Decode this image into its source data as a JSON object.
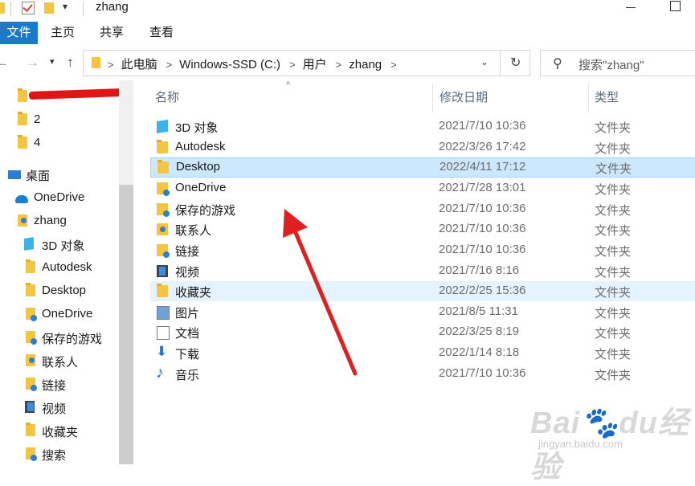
{
  "window": {
    "title": "zhang"
  },
  "ribbon": {
    "tabs": [
      "文件",
      "主页",
      "共享",
      "查看"
    ]
  },
  "address": {
    "breadcrumbs": [
      "此电脑",
      "Windows-SSD (C:)",
      "用户",
      "zhang"
    ],
    "search_placeholder": "搜索\"zhang\""
  },
  "nav_pane": {
    "items": [
      {
        "label": "2",
        "icon": "folder-icon"
      },
      {
        "label": "4",
        "icon": "folder-icon"
      },
      {
        "label": "桌面",
        "icon": "desktop-icon"
      },
      {
        "label": "OneDrive",
        "icon": "onedrive-icon"
      },
      {
        "label": "zhang",
        "icon": "user-folder-icon"
      },
      {
        "label": "3D 对象",
        "icon": "cube-icon"
      },
      {
        "label": "Autodesk",
        "icon": "folder-icon"
      },
      {
        "label": "Desktop",
        "icon": "folder-icon"
      },
      {
        "label": "OneDrive",
        "icon": "onedrive-folder-icon"
      },
      {
        "label": "保存的游戏",
        "icon": "saved-games-icon"
      },
      {
        "label": "联系人",
        "icon": "contacts-icon"
      },
      {
        "label": "链接",
        "icon": "links-icon"
      },
      {
        "label": "视频",
        "icon": "video-icon"
      },
      {
        "label": "收藏夹",
        "icon": "favorites-icon"
      },
      {
        "label": "搜索",
        "icon": "searches-icon"
      }
    ]
  },
  "columns": {
    "name": "名称",
    "modified": "修改日期",
    "type": "类型"
  },
  "files": [
    {
      "name": "3D 对象",
      "modified": "2021/7/10 10:36",
      "type": "文件夹",
      "icon": "cube-icon"
    },
    {
      "name": "Autodesk",
      "modified": "2022/3/26 17:42",
      "type": "文件夹",
      "icon": "folder-icon"
    },
    {
      "name": "Desktop",
      "modified": "2022/4/11 17:12",
      "type": "文件夹",
      "icon": "folder-icon",
      "selected": true
    },
    {
      "name": "OneDrive",
      "modified": "2021/7/28 13:01",
      "type": "文件夹",
      "icon": "onedrive-folder-icon"
    },
    {
      "name": "保存的游戏",
      "modified": "2021/7/10 10:36",
      "type": "文件夹",
      "icon": "saved-games-icon"
    },
    {
      "name": "联系人",
      "modified": "2021/7/10 10:36",
      "type": "文件夹",
      "icon": "contacts-icon"
    },
    {
      "name": "链接",
      "modified": "2021/7/10 10:36",
      "type": "文件夹",
      "icon": "links-icon"
    },
    {
      "name": "视频",
      "modified": "2021/7/16 8:16",
      "type": "文件夹",
      "icon": "video-icon"
    },
    {
      "name": "收藏夹",
      "modified": "2022/2/25 15:36",
      "type": "文件夹",
      "icon": "favorites-icon",
      "hover": true
    },
    {
      "name": "图片",
      "modified": "2021/8/5 11:31",
      "type": "文件夹",
      "icon": "pictures-icon"
    },
    {
      "name": "文档",
      "modified": "2022/3/25 8:19",
      "type": "文件夹",
      "icon": "documents-icon"
    },
    {
      "name": "下载",
      "modified": "2022/1/14 8:18",
      "type": "文件夹",
      "icon": "downloads-icon"
    },
    {
      "name": "音乐",
      "modified": "2021/7/10 10:36",
      "type": "文件夹",
      "icon": "music-icon"
    }
  ],
  "watermark": {
    "brand": "Baidu经验",
    "url": "jingyan.baidu.com"
  },
  "colors": {
    "accent": "#1979ca",
    "selection": "#cce8ff",
    "arrow": "#e02020"
  }
}
